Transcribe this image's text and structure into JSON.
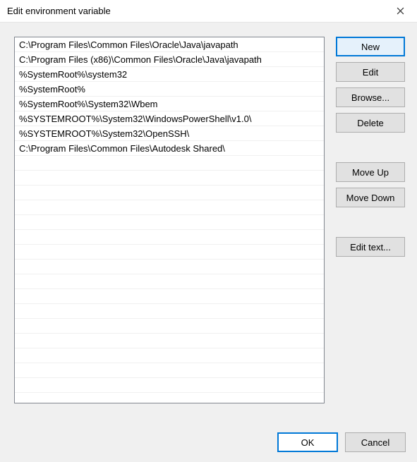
{
  "title": "Edit environment variable",
  "paths": [
    "C:\\Program Files\\Common Files\\Oracle\\Java\\javapath",
    "C:\\Program Files (x86)\\Common Files\\Oracle\\Java\\javapath",
    "%SystemRoot%\\system32",
    "%SystemRoot%",
    "%SystemRoot%\\System32\\Wbem",
    "%SYSTEMROOT%\\System32\\WindowsPowerShell\\v1.0\\",
    "%SYSTEMROOT%\\System32\\OpenSSH\\",
    "C:\\Program Files\\Common Files\\Autodesk Shared\\"
  ],
  "buttons": {
    "new": "New",
    "edit": "Edit",
    "browse": "Browse...",
    "delete": "Delete",
    "moveup": "Move Up",
    "movedown": "Move Down",
    "edittext": "Edit text...",
    "ok": "OK",
    "cancel": "Cancel"
  },
  "total_rows": 24
}
